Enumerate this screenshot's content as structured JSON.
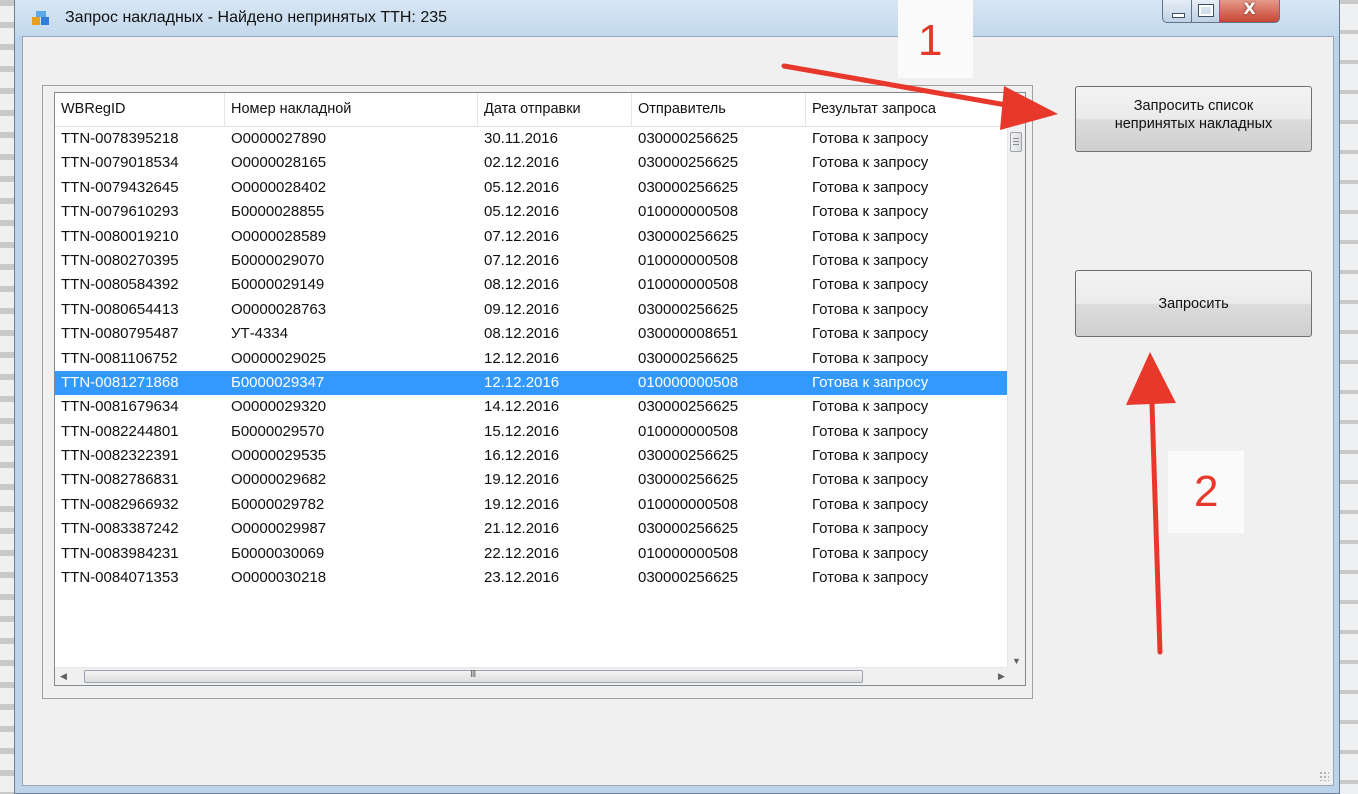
{
  "window": {
    "title": "Запрос накладных - Найдено непринятых ТТН: 235",
    "close_glyph": "X"
  },
  "grid": {
    "columns": [
      "WBRegID",
      "Номер накладной",
      "Дата отправки",
      "Отправитель",
      "Результат запроса"
    ],
    "rows": [
      [
        "TTN-0078395218",
        "О0000027890",
        "30.11.2016",
        "030000256625",
        "Готова к запросу"
      ],
      [
        "TTN-0079018534",
        "О0000028165",
        "02.12.2016",
        "030000256625",
        "Готова к запросу"
      ],
      [
        "TTN-0079432645",
        "О0000028402",
        "05.12.2016",
        "030000256625",
        "Готова к запросу"
      ],
      [
        "TTN-0079610293",
        "Б0000028855",
        "05.12.2016",
        "010000000508",
        "Готова к запросу"
      ],
      [
        "TTN-0080019210",
        "О0000028589",
        "07.12.2016",
        "030000256625",
        "Готова к запросу"
      ],
      [
        "TTN-0080270395",
        "Б0000029070",
        "07.12.2016",
        "010000000508",
        "Готова к запросу"
      ],
      [
        "TTN-0080584392",
        "Б0000029149",
        "08.12.2016",
        "010000000508",
        "Готова к запросу"
      ],
      [
        "TTN-0080654413",
        "О0000028763",
        "09.12.2016",
        "030000256625",
        "Готова к запросу"
      ],
      [
        "TTN-0080795487",
        "УТ-4334",
        "08.12.2016",
        "030000008651",
        "Готова к запросу"
      ],
      [
        "TTN-0081106752",
        "О0000029025",
        "12.12.2016",
        "030000256625",
        "Готова к запросу"
      ],
      [
        "TTN-0081271868",
        "Б0000029347",
        "12.12.2016",
        "010000000508",
        "Готова к запросу"
      ],
      [
        "TTN-0081679634",
        "О0000029320",
        "14.12.2016",
        "030000256625",
        "Готова к запросу"
      ],
      [
        "TTN-0082244801",
        "Б0000029570",
        "15.12.2016",
        "010000000508",
        "Готова к запросу"
      ],
      [
        "TTN-0082322391",
        "О0000029535",
        "16.12.2016",
        "030000256625",
        "Готова к запросу"
      ],
      [
        "TTN-0082786831",
        "О0000029682",
        "19.12.2016",
        "030000256625",
        "Готова к запросу"
      ],
      [
        "TTN-0082966932",
        "Б0000029782",
        "19.12.2016",
        "010000000508",
        "Готова к запросу"
      ],
      [
        "TTN-0083387242",
        "О0000029987",
        "21.12.2016",
        "030000256625",
        "Готова к запросу"
      ],
      [
        "TTN-0083984231",
        "Б0000030069",
        "22.12.2016",
        "010000000508",
        "Готова к запросу"
      ],
      [
        "TTN-0084071353",
        "О0000030218",
        "23.12.2016",
        "030000256625",
        "Готова к запросу"
      ]
    ],
    "selected_row": 10,
    "hscroll_grip": "III"
  },
  "buttons": {
    "request_list_line1": "Запросить список",
    "request_list_line2": "непринятых накладных",
    "request": "Запросить"
  },
  "annotations": {
    "step1": "1",
    "step2": "2",
    "color": "#e8372b"
  },
  "colors": {
    "selection": "#3399ff",
    "titlebar": "#c3d8ec"
  }
}
